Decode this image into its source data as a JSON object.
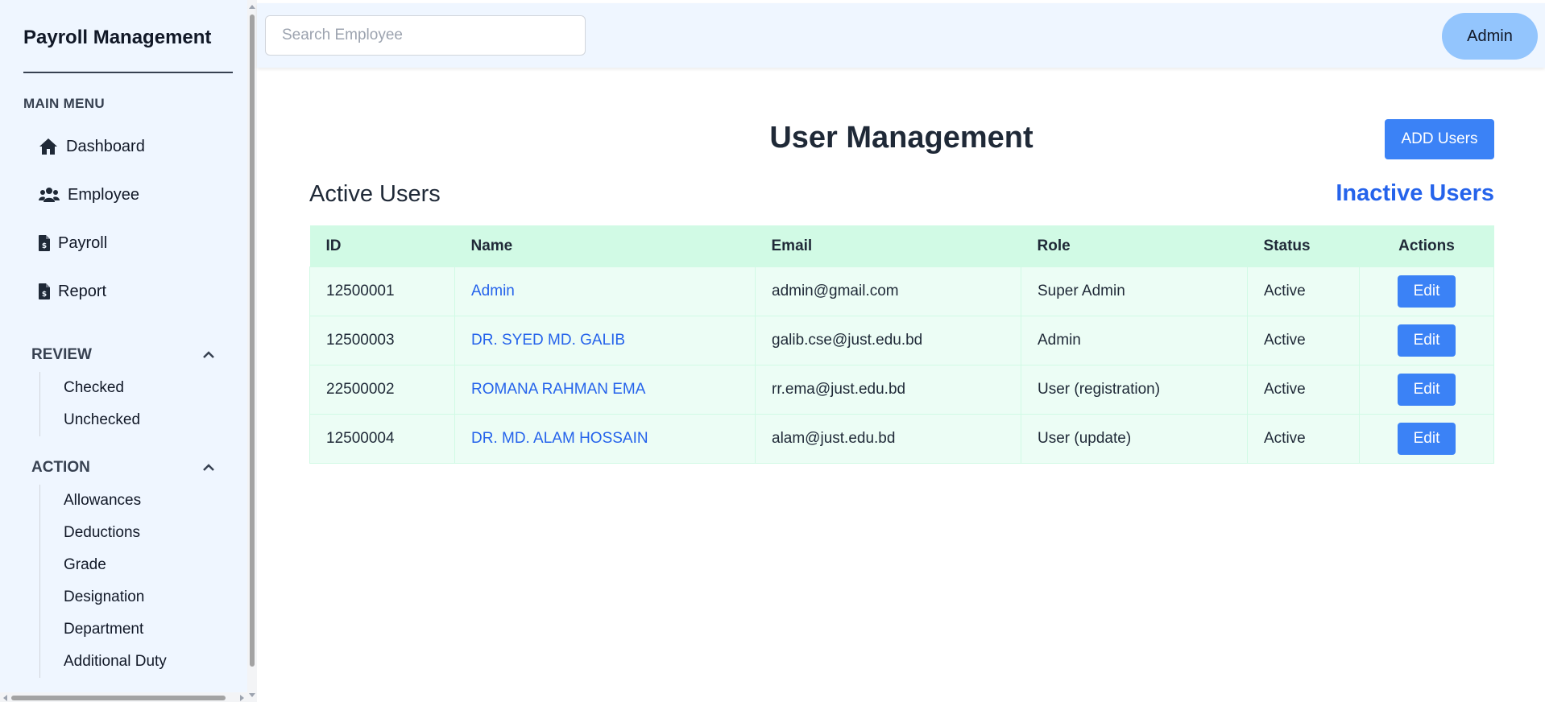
{
  "sidebar": {
    "brand": "Payroll Management",
    "main_menu_heading": "MAIN MENU",
    "nav": [
      {
        "label": "Dashboard",
        "icon": "home-icon"
      },
      {
        "label": "Employee",
        "icon": "users-icon"
      },
      {
        "label": "Payroll",
        "icon": "invoice-dollar-icon"
      },
      {
        "label": "Report",
        "icon": "invoice-dollar-icon"
      }
    ],
    "review": {
      "heading": "REVIEW",
      "items": [
        "Checked",
        "Unchecked"
      ]
    },
    "action": {
      "heading": "ACTION",
      "items": [
        "Allowances",
        "Deductions",
        "Grade",
        "Designation",
        "Department",
        "Additional Duty"
      ]
    }
  },
  "topbar": {
    "search_placeholder": "Search Employee",
    "search_value": "",
    "user_button": "Admin"
  },
  "main": {
    "title": "User Management",
    "add_button": "ADD Users",
    "active_heading": "Active Users",
    "inactive_link": "Inactive Users",
    "table": {
      "headers": {
        "id": "ID",
        "name": "Name",
        "email": "Email",
        "role": "Role",
        "status": "Status",
        "actions": "Actions"
      },
      "rows": [
        {
          "id": "12500001",
          "name": "Admin",
          "email": "admin@gmail.com",
          "role": "Super Admin",
          "status": "Active",
          "action": "Edit"
        },
        {
          "id": "12500003",
          "name": "DR. SYED MD. GALIB",
          "email": "galib.cse@just.edu.bd",
          "role": "Admin",
          "status": "Active",
          "action": "Edit"
        },
        {
          "id": "22500002",
          "name": "ROMANA RAHMAN EMA",
          "email": "rr.ema@just.edu.bd",
          "role": "User (registration)",
          "status": "Active",
          "action": "Edit"
        },
        {
          "id": "12500004",
          "name": "DR. MD. ALAM HOSSAIN",
          "email": "alam@just.edu.bd",
          "role": "User (update)",
          "status": "Active",
          "action": "Edit"
        }
      ]
    }
  },
  "colors": {
    "accent": "#3b82f6",
    "link": "#2563eb",
    "sidebar_bg": "#eff6ff",
    "table_header_bg": "#d1fae5",
    "table_row_bg": "#ecfdf5",
    "user_button_bg": "#93c5fd"
  }
}
